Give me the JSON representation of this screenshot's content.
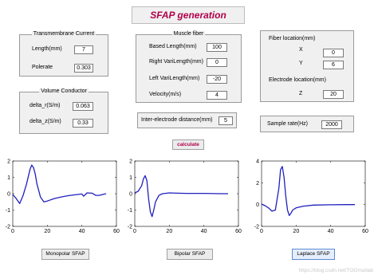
{
  "title": "SFAP generation",
  "transmembrane": {
    "title": "Transmembrane Current",
    "length_label": "Length(mm)",
    "length_value": "7",
    "polerate_label": "Polerate",
    "polerate_value": "0.303"
  },
  "volume": {
    "title": "Volume Conductor",
    "dr_label": "delta_r(S/m)",
    "dr_value": "0.063",
    "dz_label": "delta_z(S/m)",
    "dz_value": "0.33"
  },
  "muscle": {
    "title": "Muscle fiber",
    "based_label": "Based Length(mm)",
    "based_value": "100",
    "right_label": "Right VariLength(mm)",
    "right_value": "0",
    "left_label": "Left VariLength(mm)",
    "left_value": "-20",
    "vel_label": "Velocity(m/s)",
    "vel_value": "4"
  },
  "interelec": {
    "label": "Inter-electrode distance(mm)",
    "value": "5"
  },
  "fiber": {
    "title": "Fiber location(mm)",
    "x_label": "X",
    "x_value": "0",
    "y_label": "Y",
    "y_value": "6",
    "electrode_title": "Electrode location(mm)",
    "z_label": "Z",
    "z_value": "20"
  },
  "sample": {
    "label": "Sample rate(Hz)",
    "value": "2000"
  },
  "calculate_label": "calculate",
  "buttons": {
    "monopolar": "Monopolar SFAP",
    "bipolar": "Bipolar SFAP",
    "laplace": "Laplace SFAP"
  },
  "watermark": "https://blog.csdn.net/TOOmatlab",
  "chart_data": [
    {
      "type": "line",
      "xlim": [
        0,
        60
      ],
      "ylim": [
        -2,
        2
      ],
      "xticks": [
        "0",
        "20",
        "40",
        "60"
      ],
      "yticks": [
        "2",
        "1",
        "0",
        "-1",
        "-2"
      ],
      "series": [
        {
          "color": "#1f1fbf",
          "x": [
            0,
            2,
            4,
            6,
            8,
            10,
            11,
            12,
            13,
            14,
            16,
            18,
            20,
            24,
            28,
            32,
            36,
            39,
            40,
            41,
            43,
            46,
            48,
            50,
            52,
            54
          ],
          "y": [
            -0.05,
            -0.3,
            -0.6,
            -0.1,
            0.6,
            1.5,
            1.75,
            1.6,
            1.2,
            0.6,
            -0.2,
            -0.5,
            -0.45,
            -0.3,
            -0.2,
            -0.12,
            -0.07,
            -0.03,
            -0.02,
            -0.15,
            0.05,
            0.03,
            -0.1,
            -0.1,
            -0.05,
            0.0
          ]
        }
      ]
    },
    {
      "type": "line",
      "xlim": [
        0,
        60
      ],
      "ylim": [
        -2,
        2
      ],
      "xticks": [
        "0",
        "20",
        "40",
        "60"
      ],
      "yticks": [
        "2",
        "1",
        "0",
        "-1",
        "-2"
      ],
      "series": [
        {
          "color": "#1f1fbf",
          "x": [
            0,
            2,
            4,
            5,
            6,
            7,
            8,
            9,
            10,
            11,
            12,
            14,
            16,
            20,
            25,
            30,
            40,
            50,
            54
          ],
          "y": [
            0.05,
            0.15,
            0.5,
            0.9,
            1.1,
            0.8,
            -0.3,
            -1.1,
            -1.4,
            -1.0,
            -0.5,
            -0.1,
            0.0,
            0.05,
            0.03,
            0.02,
            0.02,
            0.0,
            0.0
          ]
        }
      ]
    },
    {
      "type": "line",
      "xlim": [
        0,
        60
      ],
      "ylim": [
        -2,
        4
      ],
      "xticks": [
        "0",
        "20",
        "40",
        "60"
      ],
      "yticks": [
        "4",
        "2",
        "0",
        "-2"
      ],
      "series": [
        {
          "color": "#1f1fbf",
          "x": [
            0,
            2,
            4,
            6,
            8,
            10,
            11,
            12,
            13,
            14,
            15,
            16,
            17,
            18,
            20,
            24,
            30,
            40,
            50,
            54
          ],
          "y": [
            0.05,
            -0.1,
            -0.3,
            -0.6,
            -0.5,
            1.5,
            3.2,
            3.5,
            2.5,
            0.8,
            -0.5,
            -1.0,
            -0.8,
            -0.5,
            -0.3,
            -0.15,
            -0.05,
            -0.02,
            0.0,
            0.0
          ]
        }
      ]
    }
  ]
}
